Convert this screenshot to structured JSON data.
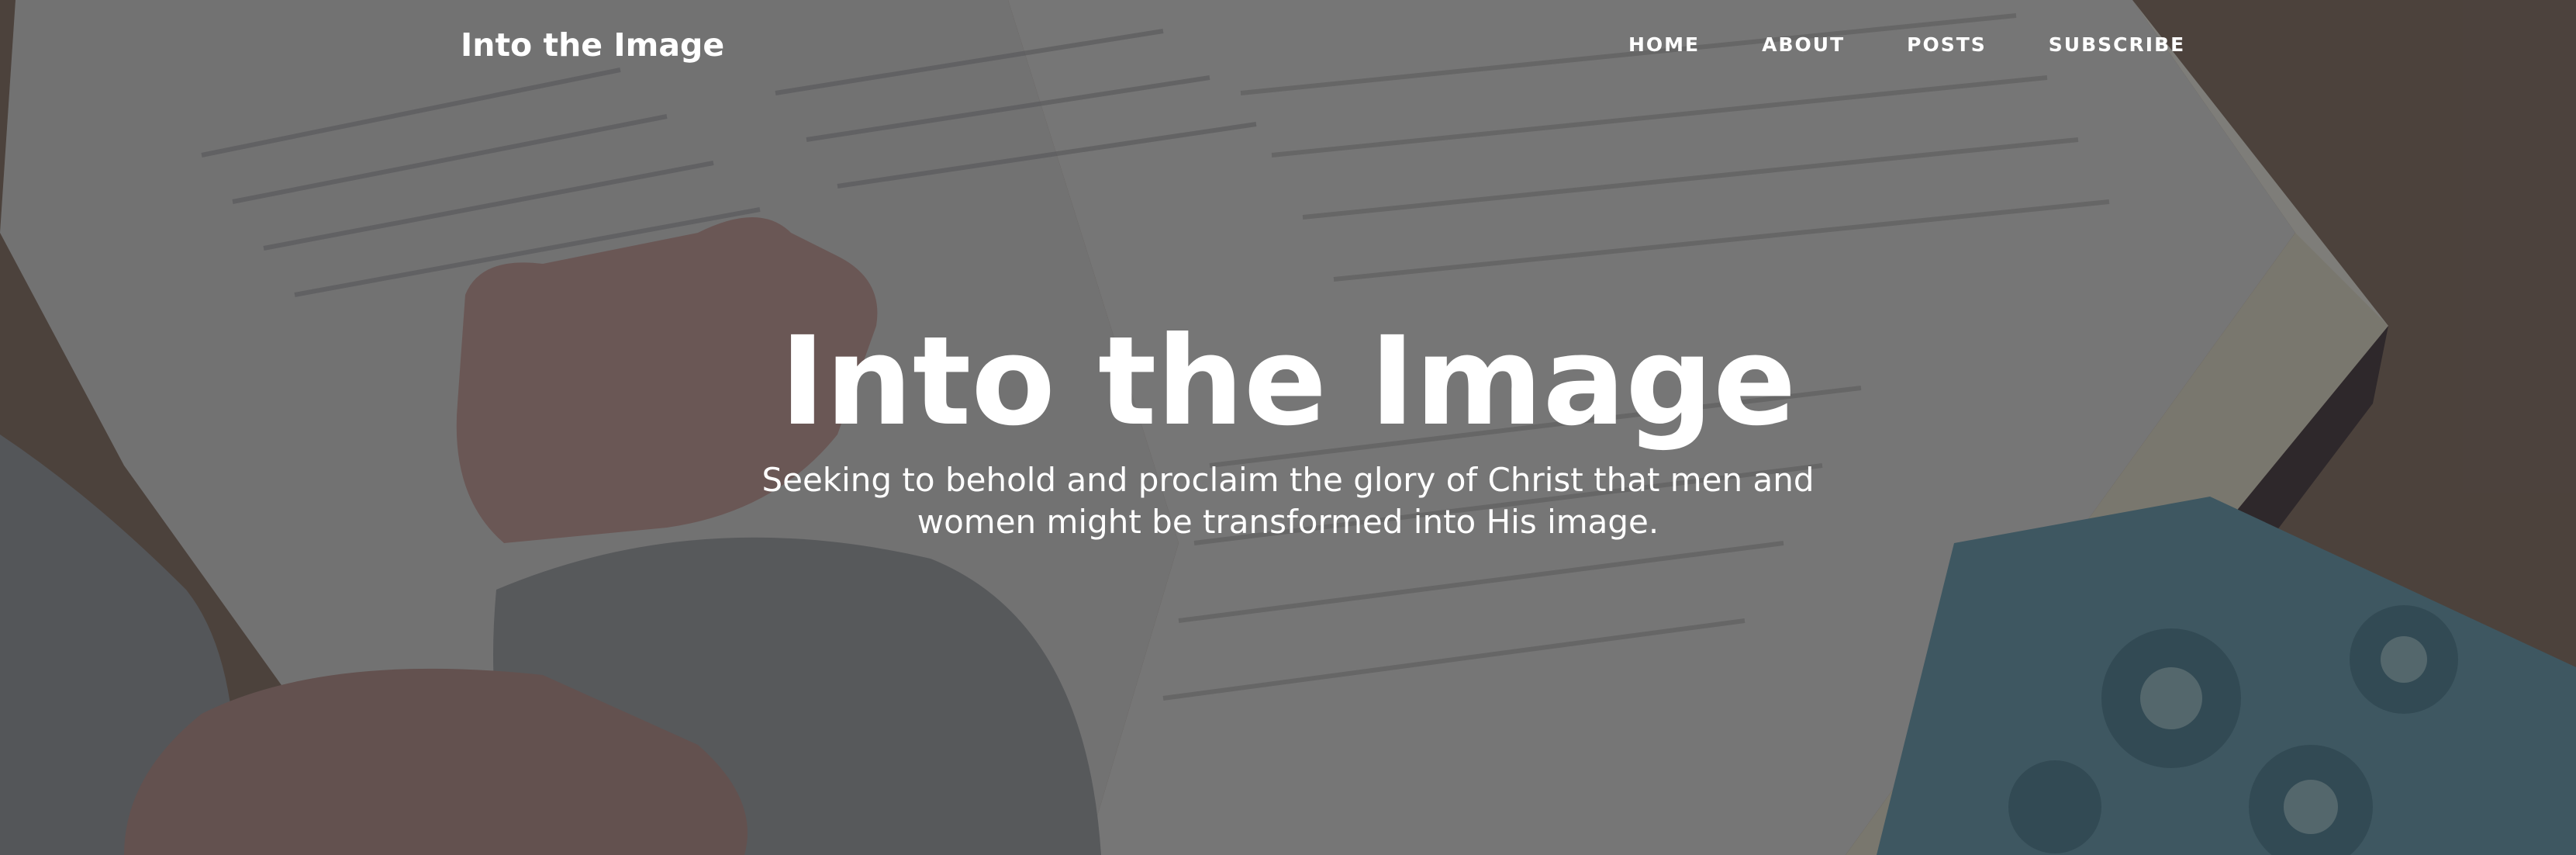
{
  "nav": {
    "brand": "Into the Image",
    "links": [
      {
        "label": "HOME"
      },
      {
        "label": "ABOUT"
      },
      {
        "label": "POSTS"
      },
      {
        "label": "SUBSCRIBE"
      }
    ]
  },
  "hero": {
    "title": "Into the Image",
    "subtitle": "Seeking to behold and proclaim the glory of Christ that men and women might be transformed into His image."
  },
  "colors": {
    "text": "#ffffff",
    "overlay": "#222632"
  },
  "background": {
    "description_icon": "open-bible-photo"
  }
}
